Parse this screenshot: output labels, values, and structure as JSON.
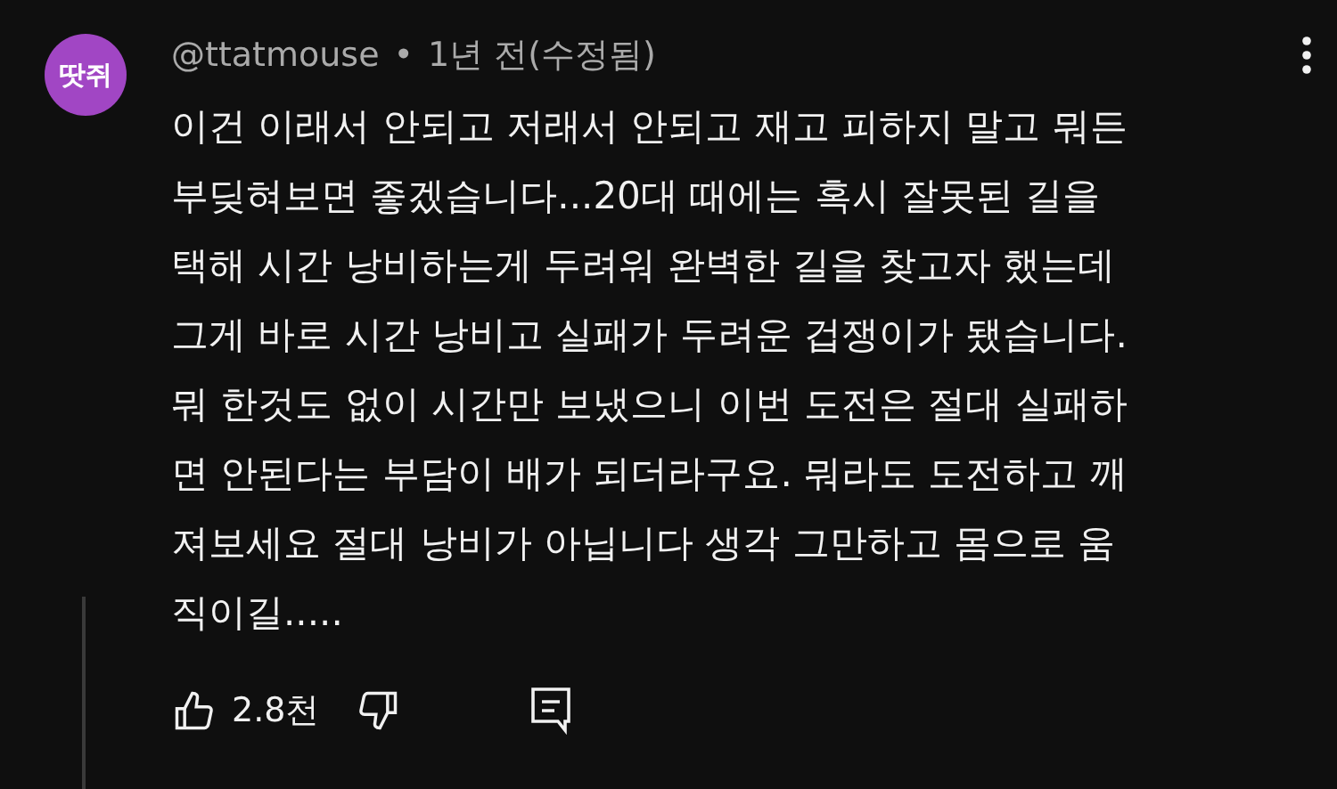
{
  "comment": {
    "avatar_text": "땃쥐",
    "author": "@ttatmouse",
    "separator": "•",
    "time": "1년 전(수정됨)",
    "lines": [
      "이건 이래서 안되고 저래서 안되고 재고 피하지 말고 뭐든",
      "부딪혀보면 좋겠습니다...20대 때에는 혹시 잘못된 길을",
      "택해 시간 낭비하는게 두려워 완벽한 길을 찾고자 했는데",
      "그게 바로 시간 낭비고 실패가 두려운 겁쟁이가 됐습니다.",
      "뭐 한것도 없이 시간만 보냈으니 이번 도전은 절대 실패하",
      "면 안된다는 부담이 배가 되더라구요. 뭐라도 도전하고 깨",
      "져보세요 절대 낭비가 아닙니다 생각 그만하고 몸으로 움",
      "직이길....."
    ],
    "like_count": "2.8천"
  }
}
